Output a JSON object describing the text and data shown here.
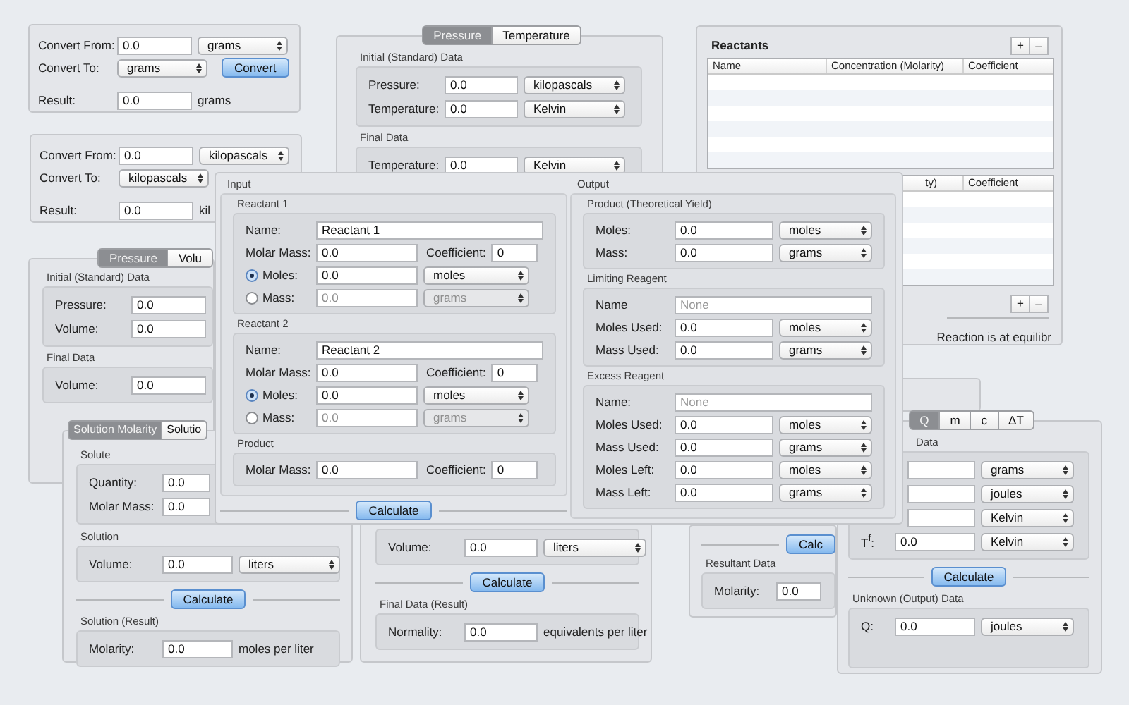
{
  "panels": [
    {
      "kind": "form",
      "sections": [
        {
          "kind": "rows",
          "rows": [
            {
              "cells": [
                {
                  "kind": "label",
                  "text": "Convert From:"
                },
                {
                  "kind": "field",
                  "value": "0.0"
                },
                {
                  "kind": "select",
                  "value": "grams"
                }
              ]
            },
            {
              "cells": [
                {
                  "kind": "label",
                  "text": "Convert To:"
                },
                {
                  "kind": "select",
                  "value": "grams"
                },
                {
                  "kind": "button",
                  "label": "Convert"
                }
              ]
            }
          ]
        },
        {
          "kind": "rows",
          "rows": [
            {
              "cells": [
                {
                  "kind": "label",
                  "text": "Result:"
                },
                {
                  "kind": "field",
                  "value": "0.0"
                },
                {
                  "kind": "text",
                  "text": "grams"
                }
              ]
            }
          ]
        }
      ]
    },
    {
      "kind": "form",
      "sections": [
        {
          "kind": "rows",
          "rows": [
            {
              "cells": [
                {
                  "kind": "label",
                  "text": "Convert From:"
                },
                {
                  "kind": "field",
                  "value": "0.0"
                },
                {
                  "kind": "select",
                  "value": "kilopascals"
                }
              ]
            },
            {
              "cells": [
                {
                  "kind": "label",
                  "text": "Convert To:"
                },
                {
                  "kind": "select",
                  "value": "kilopascals"
                }
              ]
            }
          ]
        },
        {
          "kind": "rows",
          "rows": [
            {
              "cells": [
                {
                  "kind": "label",
                  "text": "Result:"
                },
                {
                  "kind": "field",
                  "value": "0.0"
                },
                {
                  "kind": "text",
                  "text": "kil"
                }
              ]
            }
          ]
        }
      ]
    },
    {
      "kind": "form",
      "tabs": [
        {
          "label": "Pressure",
          "selected": true
        },
        {
          "label": "Temperature",
          "selected": false
        }
      ],
      "sections": [
        {
          "kind": "group",
          "title": "Initial (Standard) Data",
          "rows": [
            {
              "cells": [
                {
                  "kind": "label",
                  "text": "Pressure:"
                },
                {
                  "kind": "field",
                  "value": "0.0"
                },
                {
                  "kind": "select",
                  "value": "kilopascals"
                }
              ]
            },
            {
              "cells": [
                {
                  "kind": "label",
                  "text": "Temperature:"
                },
                {
                  "kind": "field",
                  "value": "0.0"
                },
                {
                  "kind": "select",
                  "value": "Kelvin"
                }
              ]
            }
          ]
        },
        {
          "kind": "group",
          "title": "Final Data",
          "rows": [
            {
              "cells": [
                {
                  "kind": "label",
                  "text": "Temperature:"
                },
                {
                  "kind": "field",
                  "value": "0.0"
                },
                {
                  "kind": "select",
                  "value": "Kelvin"
                }
              ]
            }
          ]
        }
      ]
    },
    {
      "kind": "equilibrium",
      "title": "Reactants",
      "tables": [
        {
          "columns": [
            "Name",
            "Concentration (Molarity)",
            "Coefficient"
          ],
          "buttons": [
            {
              "label": "+",
              "disabled": false
            },
            {
              "label": "–",
              "disabled": true
            }
          ]
        },
        {
          "columns": [
            "ty)",
            "Coefficient"
          ],
          "buttons": [
            {
              "label": "+",
              "disabled": false
            },
            {
              "label": "–",
              "disabled": true
            }
          ]
        }
      ],
      "status": "Reaction is at equilibr"
    },
    {
      "kind": "form",
      "tabs": [
        {
          "label": "Pressure",
          "selected": true
        },
        {
          "label": "Volu",
          "selected": false
        }
      ],
      "sections": [
        {
          "kind": "group",
          "title": "Initial (Standard) Data",
          "rows": [
            {
              "cells": [
                {
                  "kind": "label",
                  "text": "Pressure:"
                },
                {
                  "kind": "field",
                  "value": "0.0"
                }
              ]
            },
            {
              "cells": [
                {
                  "kind": "label",
                  "text": "Volume:"
                },
                {
                  "kind": "field",
                  "value": "0.0"
                }
              ]
            }
          ]
        },
        {
          "kind": "group",
          "title": "Final Data",
          "rows": [
            {
              "cells": [
                {
                  "kind": "label",
                  "text": "Volume:"
                },
                {
                  "kind": "field",
                  "value": "0.0"
                }
              ]
            }
          ]
        }
      ]
    },
    {
      "kind": "split",
      "columns": [
        {
          "title": "Input",
          "groups": [
            {
              "title": "Reactant 1",
              "rows": [
                {
                  "cells": [
                    {
                      "kind": "label",
                      "text": "Name:"
                    },
                    {
                      "kind": "wide-field",
                      "value": "Reactant 1"
                    }
                  ]
                },
                {
                  "cells": [
                    {
                      "kind": "label",
                      "text": "Molar Mass:"
                    },
                    {
                      "kind": "field",
                      "value": "0.0"
                    },
                    {
                      "kind": "inline-label",
                      "text": "Coefficient:"
                    },
                    {
                      "kind": "short-field",
                      "value": "0"
                    }
                  ]
                },
                {
                  "cells": [
                    {
                      "kind": "radio",
                      "label": "Moles:",
                      "selected": true
                    },
                    {
                      "kind": "field",
                      "value": "0.0",
                      "disabled": false
                    },
                    {
                      "kind": "select",
                      "value": "moles",
                      "disabled": false
                    }
                  ]
                },
                {
                  "cells": [
                    {
                      "kind": "radio",
                      "label": "Mass:",
                      "selected": false
                    },
                    {
                      "kind": "field",
                      "value": "0.0",
                      "disabled": true
                    },
                    {
                      "kind": "select",
                      "value": "grams",
                      "disabled": true
                    }
                  ]
                }
              ]
            },
            {
              "title": "Reactant 2",
              "rows": [
                {
                  "cells": [
                    {
                      "kind": "label",
                      "text": "Name:"
                    },
                    {
                      "kind": "wide-field",
                      "value": "Reactant 2"
                    }
                  ]
                },
                {
                  "cells": [
                    {
                      "kind": "label",
                      "text": "Molar Mass:"
                    },
                    {
                      "kind": "field",
                      "value": "0.0"
                    },
                    {
                      "kind": "inline-label",
                      "text": "Coefficient:"
                    },
                    {
                      "kind": "short-field",
                      "value": "0"
                    }
                  ]
                },
                {
                  "cells": [
                    {
                      "kind": "radio",
                      "label": "Moles:",
                      "selected": true
                    },
                    {
                      "kind": "field",
                      "value": "0.0",
                      "disabled": false
                    },
                    {
                      "kind": "select",
                      "value": "moles",
                      "disabled": false
                    }
                  ]
                },
                {
                  "cells": [
                    {
                      "kind": "radio",
                      "label": "Mass:",
                      "selected": false
                    },
                    {
                      "kind": "field",
                      "value": "0.0",
                      "disabled": true
                    },
                    {
                      "kind": "select",
                      "value": "grams",
                      "disabled": true
                    }
                  ]
                }
              ]
            },
            {
              "title": "Product",
              "rows": [
                {
                  "cells": [
                    {
                      "kind": "label",
                      "text": "Molar Mass:"
                    },
                    {
                      "kind": "field",
                      "value": "0.0"
                    },
                    {
                      "kind": "inline-label",
                      "text": "Coefficient:"
                    },
                    {
                      "kind": "short-field",
                      "value": "0"
                    }
                  ]
                }
              ]
            }
          ],
          "button": "Calculate"
        },
        {
          "title": "Output",
          "groups": [
            {
              "title": "Product (Theoretical Yield)",
              "rows": [
                {
                  "cells": [
                    {
                      "kind": "label",
                      "text": "Moles:"
                    },
                    {
                      "kind": "field",
                      "value": "0.0"
                    },
                    {
                      "kind": "select",
                      "value": "moles"
                    }
                  ]
                },
                {
                  "cells": [
                    {
                      "kind": "label",
                      "text": "Mass:"
                    },
                    {
                      "kind": "field",
                      "value": "0.0"
                    },
                    {
                      "kind": "select",
                      "value": "grams"
                    }
                  ]
                }
              ]
            },
            {
              "title": "Limiting Reagent",
              "rows": [
                {
                  "cells": [
                    {
                      "kind": "label",
                      "text": "Name"
                    },
                    {
                      "kind": "wide-field",
                      "placeholder": "None"
                    }
                  ]
                },
                {
                  "cells": [
                    {
                      "kind": "label",
                      "text": "Moles Used:"
                    },
                    {
                      "kind": "field",
                      "value": "0.0"
                    },
                    {
                      "kind": "select",
                      "value": "moles"
                    }
                  ]
                },
                {
                  "cells": [
                    {
                      "kind": "label",
                      "text": "Mass Used:"
                    },
                    {
                      "kind": "field",
                      "value": "0.0"
                    },
                    {
                      "kind": "select",
                      "value": "grams"
                    }
                  ]
                }
              ]
            },
            {
              "title": "Excess Reagent",
              "rows": [
                {
                  "cells": [
                    {
                      "kind": "label",
                      "text": "Name:"
                    },
                    {
                      "kind": "wide-field",
                      "placeholder": "None"
                    }
                  ]
                },
                {
                  "cells": [
                    {
                      "kind": "label",
                      "text": "Moles Used:"
                    },
                    {
                      "kind": "field",
                      "value": "0.0"
                    },
                    {
                      "kind": "select",
                      "value": "moles"
                    }
                  ]
                },
                {
                  "cells": [
                    {
                      "kind": "label",
                      "text": "Mass Used:"
                    },
                    {
                      "kind": "field",
                      "value": "0.0"
                    },
                    {
                      "kind": "select",
                      "value": "grams"
                    }
                  ]
                },
                {
                  "cells": [
                    {
                      "kind": "label",
                      "text": "Moles Left:"
                    },
                    {
                      "kind": "field",
                      "value": "0.0"
                    },
                    {
                      "kind": "select",
                      "value": "moles"
                    }
                  ]
                },
                {
                  "cells": [
                    {
                      "kind": "label",
                      "text": "Mass Left:"
                    },
                    {
                      "kind": "field",
                      "value": "0.0"
                    },
                    {
                      "kind": "select",
                      "value": "grams"
                    }
                  ]
                }
              ]
            }
          ]
        }
      ]
    },
    {
      "kind": "form",
      "tabs": [
        {
          "label": "Solution Molarity",
          "selected": true
        },
        {
          "label": "Solutio",
          "selected": false
        }
      ],
      "sections": [
        {
          "kind": "group",
          "title": "Solute",
          "rows": [
            {
              "cells": [
                {
                  "kind": "label",
                  "text": "Quantity:"
                },
                {
                  "kind": "field",
                  "value": "0.0"
                }
              ]
            },
            {
              "cells": [
                {
                  "kind": "label",
                  "text": "Molar Mass:"
                },
                {
                  "kind": "field",
                  "value": "0.0"
                }
              ]
            }
          ]
        },
        {
          "kind": "group",
          "title": "Solution",
          "rows": [
            {
              "cells": [
                {
                  "kind": "label",
                  "text": "Volume:"
                },
                {
                  "kind": "field",
                  "value": "0.0"
                },
                {
                  "kind": "select",
                  "value": "liters"
                }
              ]
            }
          ]
        },
        {
          "kind": "calculate",
          "label": "Calculate"
        },
        {
          "kind": "group",
          "title": "Solution (Result)",
          "rows": [
            {
              "cells": [
                {
                  "kind": "label",
                  "text": "Molarity:"
                },
                {
                  "kind": "field",
                  "value": "0.0"
                },
                {
                  "kind": "text",
                  "text": "moles per liter"
                }
              ]
            }
          ]
        }
      ]
    },
    {
      "kind": "form",
      "sections": [
        {
          "kind": "group",
          "rows": [
            {
              "cells": [
                {
                  "kind": "label",
                  "text": "Volume:"
                },
                {
                  "kind": "field",
                  "value": "0.0"
                },
                {
                  "kind": "select",
                  "value": "liters"
                }
              ]
            }
          ]
        },
        {
          "kind": "calculate",
          "label": "Calculate"
        },
        {
          "kind": "group",
          "title": "Final Data (Result)",
          "rows": [
            {
              "cells": [
                {
                  "kind": "label",
                  "text": "Normality:"
                },
                {
                  "kind": "field",
                  "value": "0.0"
                },
                {
                  "kind": "text",
                  "text": "equivalents per liter"
                }
              ]
            }
          ]
        }
      ]
    },
    {
      "kind": "form",
      "sections": [
        {
          "kind": "calculate",
          "label": "Calc"
        },
        {
          "kind": "group",
          "title": "Resultant Data",
          "rows": [
            {
              "cells": [
                {
                  "kind": "label",
                  "text": "Molarity:"
                },
                {
                  "kind": "field",
                  "value": "0.0"
                }
              ]
            }
          ]
        }
      ]
    },
    {
      "kind": "form",
      "tabs": [
        {
          "label": "Q",
          "selected": true
        },
        {
          "label": "m",
          "selected": false
        },
        {
          "label": "c",
          "selected": false
        },
        {
          "label": "ΔT",
          "selected": false
        }
      ],
      "sections": [
        {
          "kind": "group",
          "title": "Data",
          "rows": [
            {
              "cells": [
                {
                  "kind": "field"
                },
                {
                  "kind": "select",
                  "value": "grams"
                }
              ]
            },
            {
              "cells": [
                {
                  "kind": "field"
                },
                {
                  "kind": "select",
                  "value": "joules"
                }
              ]
            },
            {
              "cells": [
                {
                  "kind": "field"
                },
                {
                  "kind": "select",
                  "value": "Kelvin"
                }
              ]
            },
            {
              "cells": [
                {
                  "kind": "label",
                  "text": "T$^{f}$:"
                },
                {
                  "kind": "field",
                  "value": "0.0"
                },
                {
                  "kind": "select",
                  "value": "Kelvin"
                }
              ]
            }
          ]
        },
        {
          "kind": "calculate",
          "label": "Calculate"
        },
        {
          "kind": "group",
          "title": "Unknown (Output) Data",
          "rows": [
            {
              "cells": [
                {
                  "kind": "label",
                  "text": "Q:"
                },
                {
                  "kind": "field",
                  "value": "0.0"
                },
                {
                  "kind": "select",
                  "value": "joules"
                }
              ]
            }
          ]
        }
      ]
    },
    {
      "kind": "blank"
    }
  ]
}
